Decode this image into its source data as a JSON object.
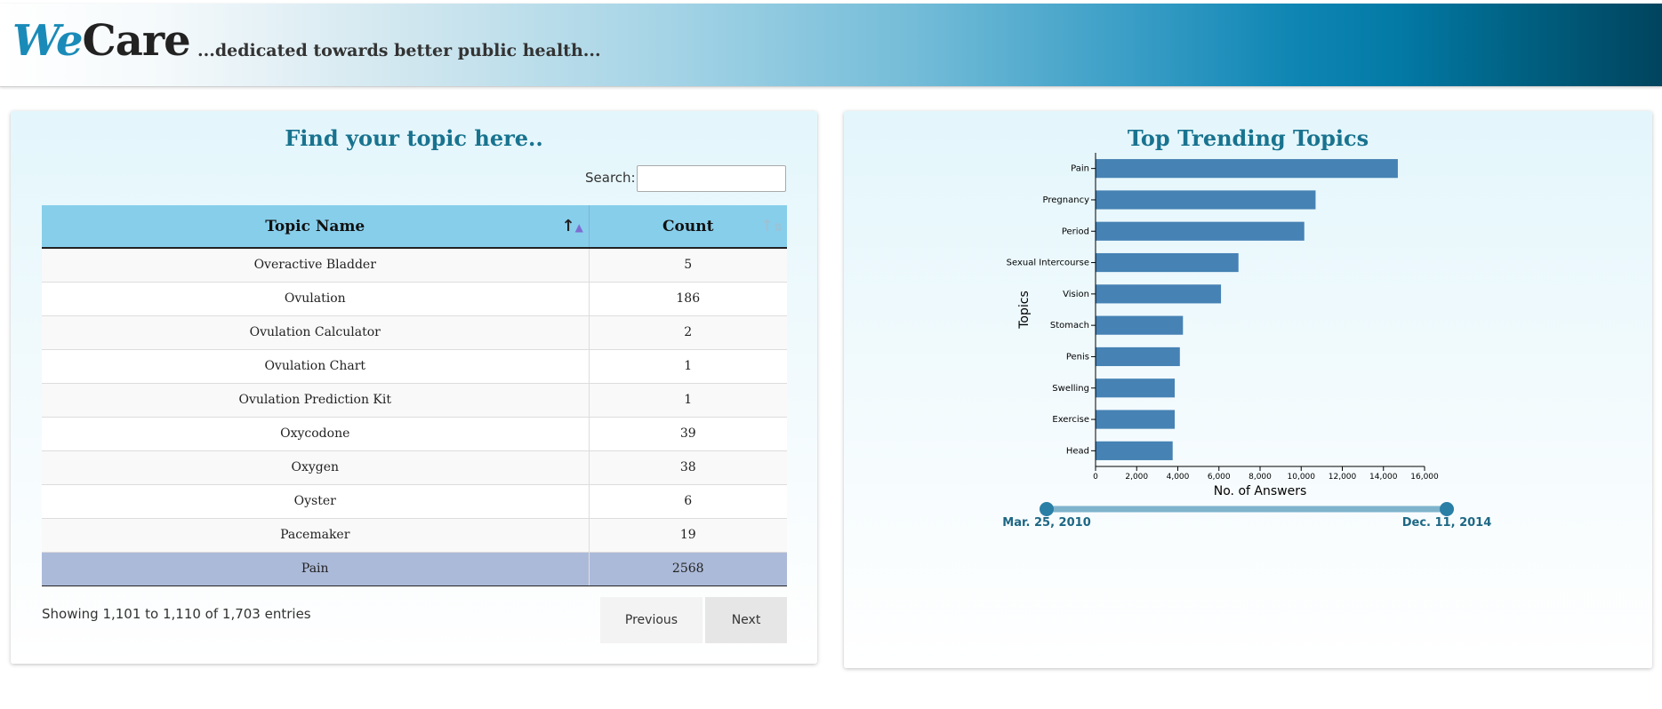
{
  "header": {
    "logo_we": "We",
    "logo_care": "Care",
    "tagline": "...dedicated towards better public health..."
  },
  "topics_panel": {
    "title": "Find your topic here..",
    "search_label": "Search:",
    "search_value": "",
    "columns": [
      "Topic Name",
      "Count"
    ],
    "rows": [
      {
        "name": "Overactive Bladder",
        "count": "5"
      },
      {
        "name": "Ovulation",
        "count": "186"
      },
      {
        "name": "Ovulation Calculator",
        "count": "2"
      },
      {
        "name": "Ovulation Chart",
        "count": "1"
      },
      {
        "name": "Ovulation Prediction Kit",
        "count": "1"
      },
      {
        "name": "Oxycodone",
        "count": "39"
      },
      {
        "name": "Oxygen",
        "count": "38"
      },
      {
        "name": "Oyster",
        "count": "6"
      },
      {
        "name": "Pacemaker",
        "count": "19"
      },
      {
        "name": "Pain",
        "count": "2568"
      }
    ],
    "selected_row": "Pain",
    "info": "Showing 1,101 to 1,110 of 1,703 entries",
    "prev_label": "Previous",
    "next_label": "Next"
  },
  "trending_panel": {
    "title": "Top Trending Topics",
    "slider": {
      "start_label": "Mar. 25, 2010",
      "end_label": "Dec. 11, 2014"
    }
  },
  "colors": {
    "bar": "#4682b4",
    "title": "#18738f",
    "header_selected_row": "#acbad9",
    "table_header": "#87ceeb",
    "slider_handle": "#2a7fa6",
    "slider_track": "#7fb3cc"
  },
  "chart_data": {
    "type": "bar",
    "orientation": "horizontal",
    "categories": [
      "Pain",
      "Pregnancy",
      "Period",
      "Sexual Intercourse",
      "Vision",
      "Stomach",
      "Penis",
      "Swelling",
      "Exercise",
      "Head"
    ],
    "values": [
      14700,
      10700,
      10150,
      6950,
      6100,
      4250,
      4100,
      3850,
      3850,
      3750
    ],
    "xlabel": "No. of Answers",
    "ylabel": "Topics",
    "xlim": [
      0,
      16000
    ],
    "x_ticks": [
      0,
      2000,
      4000,
      6000,
      8000,
      10000,
      12000,
      14000,
      16000
    ],
    "x_tick_labels": [
      "0",
      "2,000",
      "4,000",
      "6,000",
      "8,000",
      "10,000",
      "12,000",
      "14,000",
      "16,000"
    ],
    "grid": false,
    "legend": "none"
  }
}
